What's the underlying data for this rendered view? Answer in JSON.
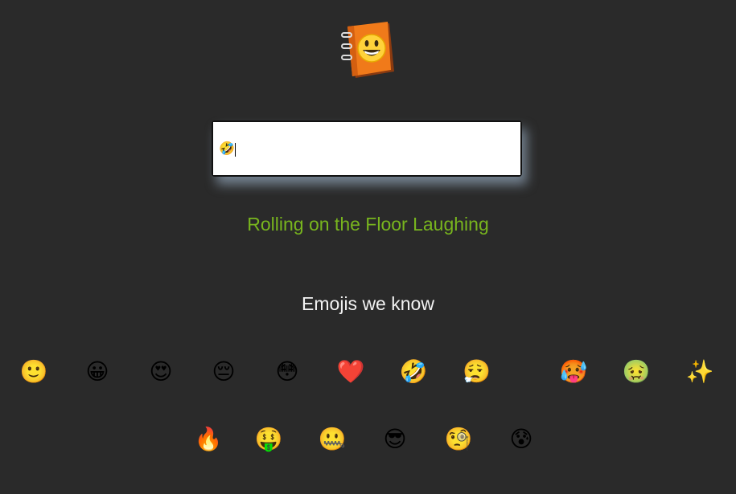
{
  "app": {
    "logo_icon": "emojipedia-book-icon"
  },
  "search": {
    "value": "🤣",
    "placeholder": ""
  },
  "result": {
    "meaning": "Rolling on the Floor Laughing"
  },
  "list": {
    "heading": "Emojis we know",
    "emojis": [
      {
        "char": "🙂",
        "icon": "slightly-smiling-face-icon"
      },
      {
        "char": "😀",
        "icon": "grinning-face-icon"
      },
      {
        "char": "😍",
        "icon": "heart-eyes-icon"
      },
      {
        "char": "😔",
        "icon": "pensive-face-icon"
      },
      {
        "char": "😳",
        "icon": "flushed-face-icon"
      },
      {
        "char": "❤️",
        "icon": "red-heart-icon"
      },
      {
        "char": "🤣",
        "icon": "rolling-on-floor-laughing-icon"
      },
      {
        "char": "😮‍💨",
        "icon": "face-exhaling-icon"
      },
      {
        "char": "🥵",
        "icon": "hot-face-icon"
      },
      {
        "char": "🤢",
        "icon": "nauseated-face-icon"
      },
      {
        "char": "✨",
        "icon": "sparkles-icon"
      },
      {
        "char": "🔥",
        "icon": "fire-icon"
      },
      {
        "char": "🤑",
        "icon": "money-mouth-face-icon"
      },
      {
        "char": "🤐",
        "icon": "zipper-mouth-face-icon"
      },
      {
        "char": "😎",
        "icon": "sunglasses-face-icon"
      },
      {
        "char": "🧐",
        "icon": "monocle-face-icon"
      },
      {
        "char": "😰",
        "icon": "anxious-face-icon"
      }
    ]
  },
  "colors": {
    "background": "#2a2a2a",
    "meaning_text": "#78b51e",
    "heading_text": "#f2f2f2",
    "emoji_yellow": "#fbc02d"
  }
}
